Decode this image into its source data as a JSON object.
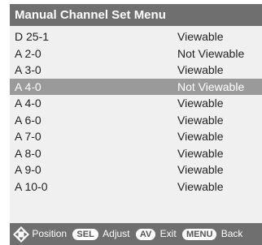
{
  "menu": {
    "title": "Manual Channel Set Menu",
    "selected_index": 3,
    "rows": [
      {
        "channel": "D 25-1",
        "status": "Viewable"
      },
      {
        "channel": "A 2-0",
        "status": "Not Viewable"
      },
      {
        "channel": "A 3-0",
        "status": "Viewable"
      },
      {
        "channel": "A 4-0",
        "status": "Not Viewable"
      },
      {
        "channel": "A 4-0",
        "status": "Viewable"
      },
      {
        "channel": "A 6-0",
        "status": "Viewable"
      },
      {
        "channel": "A 7-0",
        "status": "Viewable"
      },
      {
        "channel": "A 8-0",
        "status": "Viewable"
      },
      {
        "channel": "A 9-0",
        "status": "Viewable"
      },
      {
        "channel": "A 10-0",
        "status": "Viewable"
      }
    ]
  },
  "footer": {
    "dpad_icon": "dpad-icon",
    "position_label": "Position",
    "sel_key": "SEL",
    "adjust_label": "Adjust",
    "av_key": "AV",
    "exit_label": "Exit",
    "menu_key": "MENU",
    "back_label": "Back"
  },
  "colors": {
    "title_bar": "#6f6f6f",
    "panel_bg": "#f0f0f0",
    "highlight": "#9a9a9a",
    "text": "#222222"
  }
}
